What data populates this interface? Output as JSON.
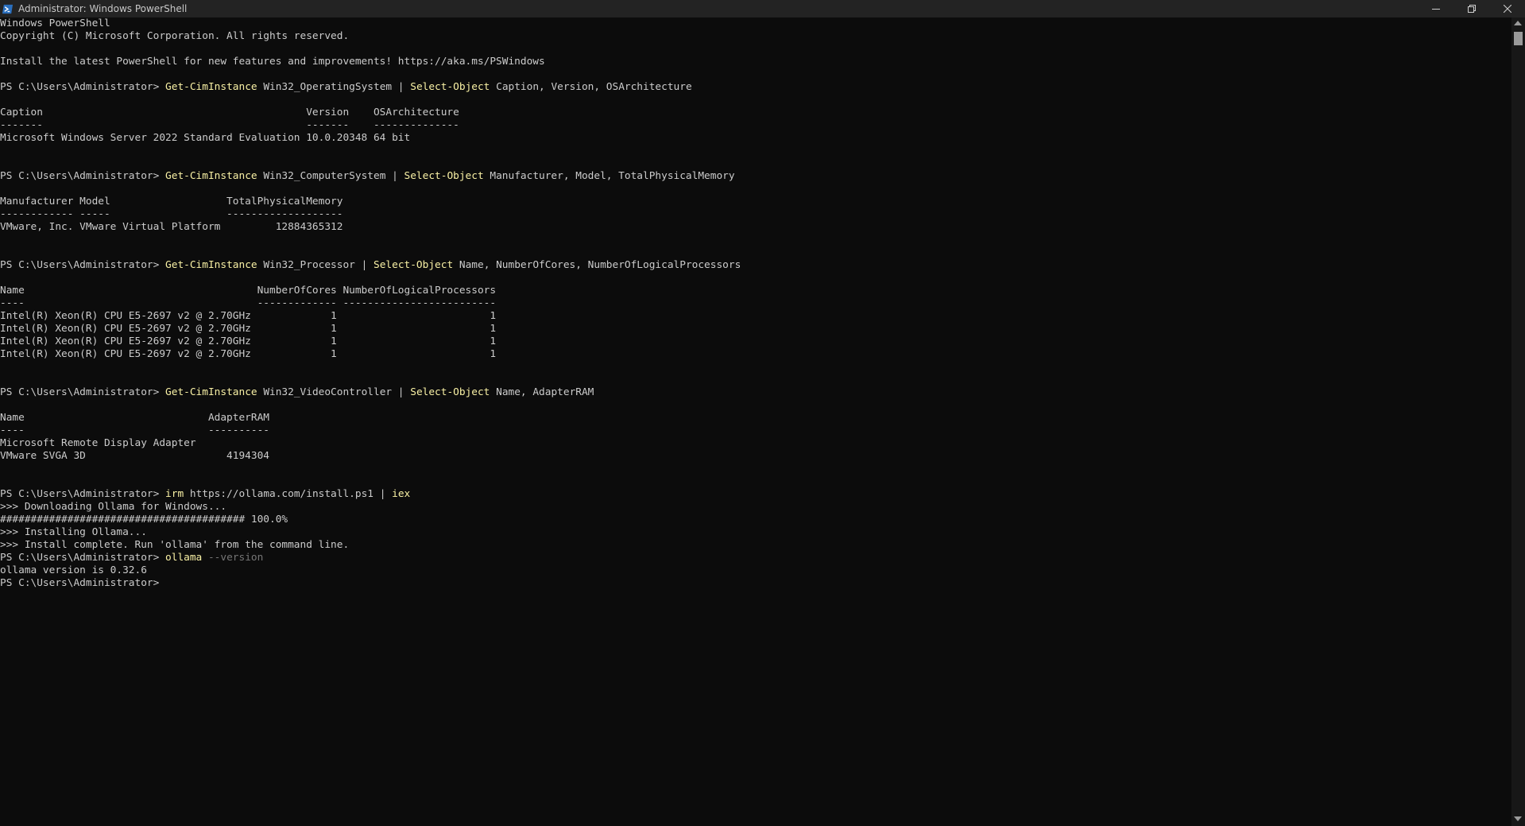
{
  "window": {
    "title": "Administrator: Windows PowerShell",
    "icon": "powershell-icon",
    "controls": [
      "minimize-icon",
      "restore-icon",
      "close-icon"
    ]
  },
  "colors": {
    "background": "#0c0c0c",
    "titlebar": "#232323",
    "text": "#cccccc",
    "command": "#f9f1a5",
    "parameter": "#767676"
  },
  "console": {
    "lines": [
      [
        {
          "t": "Windows PowerShell",
          "c": "default"
        }
      ],
      [
        {
          "t": "Copyright (C) Microsoft Corporation. All rights reserved.",
          "c": "default"
        }
      ],
      [],
      [
        {
          "t": "Install the latest PowerShell for new features and improvements! https://aka.ms/PSWindows",
          "c": "default"
        }
      ],
      [],
      [
        {
          "t": "PS C:\\Users\\Administrator> ",
          "c": "default"
        },
        {
          "t": "Get-CimInstance",
          "c": "cmd"
        },
        {
          "t": " Win32_OperatingSystem | ",
          "c": "default"
        },
        {
          "t": "Select-Object",
          "c": "cmd"
        },
        {
          "t": " Caption, Version, OSArchitecture",
          "c": "default"
        }
      ],
      [],
      [
        {
          "t": "Caption                                           Version    OSArchitecture",
          "c": "default"
        }
      ],
      [
        {
          "t": "-------                                           -------    --------------",
          "c": "default"
        }
      ],
      [
        {
          "t": "Microsoft Windows Server 2022 Standard Evaluation 10.0.20348 64 bit",
          "c": "default"
        }
      ],
      [],
      [],
      [
        {
          "t": "PS C:\\Users\\Administrator> ",
          "c": "default"
        },
        {
          "t": "Get-CimInstance",
          "c": "cmd"
        },
        {
          "t": " Win32_ComputerSystem | ",
          "c": "default"
        },
        {
          "t": "Select-Object",
          "c": "cmd"
        },
        {
          "t": " Manufacturer, Model, TotalPhysicalMemory",
          "c": "default"
        }
      ],
      [],
      [
        {
          "t": "Manufacturer Model                   TotalPhysicalMemory",
          "c": "default"
        }
      ],
      [
        {
          "t": "------------ -----                   -------------------",
          "c": "default"
        }
      ],
      [
        {
          "t": "VMware, Inc. VMware Virtual Platform         12884365312",
          "c": "default"
        }
      ],
      [],
      [],
      [
        {
          "t": "PS C:\\Users\\Administrator> ",
          "c": "default"
        },
        {
          "t": "Get-CimInstance",
          "c": "cmd"
        },
        {
          "t": " Win32_Processor | ",
          "c": "default"
        },
        {
          "t": "Select-Object",
          "c": "cmd"
        },
        {
          "t": " Name, NumberOfCores, NumberOfLogicalProcessors",
          "c": "default"
        }
      ],
      [],
      [
        {
          "t": "Name                                      NumberOfCores NumberOfLogicalProcessors",
          "c": "default"
        }
      ],
      [
        {
          "t": "----                                      ------------- -------------------------",
          "c": "default"
        }
      ],
      [
        {
          "t": "Intel(R) Xeon(R) CPU E5-2697 v2 @ 2.70GHz             1                         1",
          "c": "default"
        }
      ],
      [
        {
          "t": "Intel(R) Xeon(R) CPU E5-2697 v2 @ 2.70GHz             1                         1",
          "c": "default"
        }
      ],
      [
        {
          "t": "Intel(R) Xeon(R) CPU E5-2697 v2 @ 2.70GHz             1                         1",
          "c": "default"
        }
      ],
      [
        {
          "t": "Intel(R) Xeon(R) CPU E5-2697 v2 @ 2.70GHz             1                         1",
          "c": "default"
        }
      ],
      [],
      [],
      [
        {
          "t": "PS C:\\Users\\Administrator> ",
          "c": "default"
        },
        {
          "t": "Get-CimInstance",
          "c": "cmd"
        },
        {
          "t": " Win32_VideoController | ",
          "c": "default"
        },
        {
          "t": "Select-Object",
          "c": "cmd"
        },
        {
          "t": " Name, AdapterRAM",
          "c": "default"
        }
      ],
      [],
      [
        {
          "t": "Name                              AdapterRAM",
          "c": "default"
        }
      ],
      [
        {
          "t": "----                              ----------",
          "c": "default"
        }
      ],
      [
        {
          "t": "Microsoft Remote Display Adapter",
          "c": "default"
        }
      ],
      [
        {
          "t": "VMware SVGA 3D                       4194304",
          "c": "default"
        }
      ],
      [],
      [],
      [
        {
          "t": "PS C:\\Users\\Administrator> ",
          "c": "default"
        },
        {
          "t": "irm",
          "c": "cmd"
        },
        {
          "t": " https://ollama.com/install.ps1 | ",
          "c": "default"
        },
        {
          "t": "iex",
          "c": "cmd"
        }
      ],
      [
        {
          "t": ">>> Downloading Ollama for Windows...",
          "c": "default"
        }
      ],
      [
        {
          "t": "######################################## 100.0%",
          "c": "default"
        }
      ],
      [
        {
          "t": ">>> Installing Ollama...",
          "c": "default"
        }
      ],
      [
        {
          "t": ">>> Install complete. Run 'ollama' from the command line.",
          "c": "default"
        }
      ],
      [
        {
          "t": "PS C:\\Users\\Administrator> ",
          "c": "default"
        },
        {
          "t": "ollama",
          "c": "cmd"
        },
        {
          "t": " --version",
          "c": "param"
        }
      ],
      [
        {
          "t": "ollama version is 0.32.6",
          "c": "default"
        }
      ],
      [
        {
          "t": "PS C:\\Users\\Administrator>",
          "c": "default"
        }
      ]
    ]
  }
}
